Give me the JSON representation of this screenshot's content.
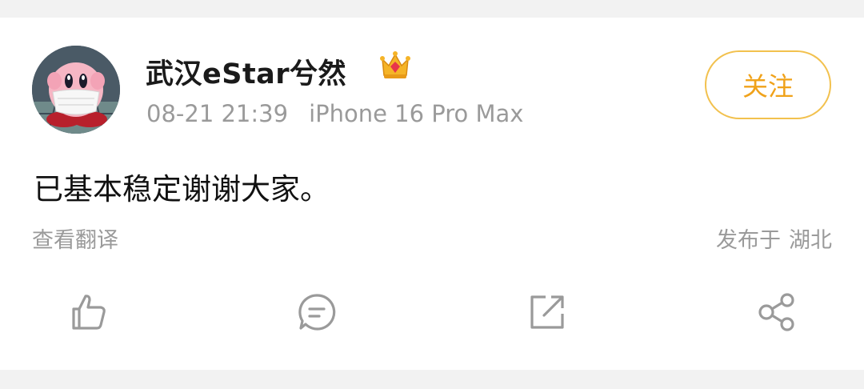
{
  "post": {
    "author": {
      "name": "武汉eStar兮然",
      "badge_icon": "crown-icon",
      "avatar_icon": "kirby-masked-avatar"
    },
    "timestamp": "08-21 21:39",
    "device": "iPhone 16 Pro Max",
    "follow_label": "关注",
    "text": "已基本稳定谢谢大家。",
    "translate_label": "查看翻译",
    "location_prefix": "发布于",
    "location": "湖北"
  },
  "actions": [
    {
      "icon": "thumbs-up-icon"
    },
    {
      "icon": "comment-icon"
    },
    {
      "icon": "repost-icon"
    },
    {
      "icon": "share-icon"
    }
  ],
  "colors": {
    "follow_text": "#f0a21a",
    "follow_border": "#f2c14e",
    "meta_text": "#9a9a9a",
    "icon_gray": "#9a9a9a",
    "page_background": "#f2f2f2",
    "card_background": "#ffffff"
  }
}
